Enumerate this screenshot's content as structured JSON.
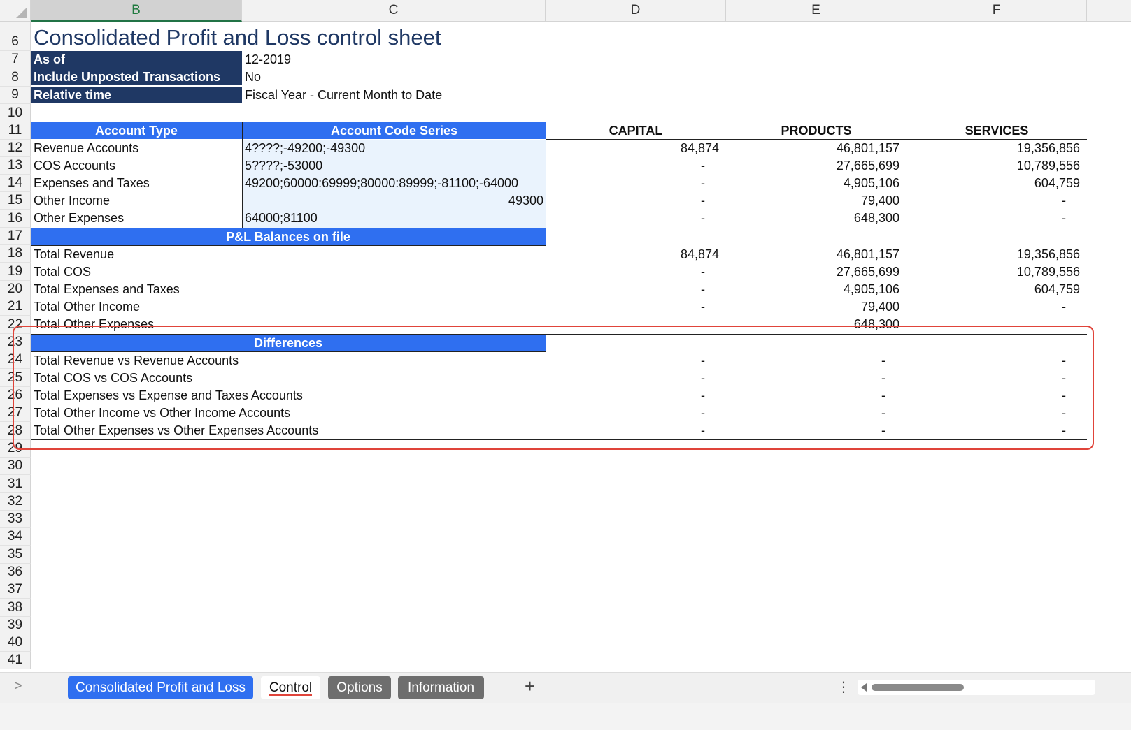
{
  "columns": [
    "B",
    "C",
    "D",
    "E",
    "F"
  ],
  "rows": [
    "6",
    "7",
    "8",
    "9",
    "10",
    "11",
    "12",
    "13",
    "14",
    "15",
    "16",
    "17",
    "18",
    "19",
    "20",
    "21",
    "22",
    "23",
    "24",
    "25",
    "26",
    "27",
    "28",
    "29",
    "30",
    "31",
    "32",
    "33",
    "34",
    "35",
    "36",
    "37",
    "38",
    "39",
    "40",
    "41"
  ],
  "title": "Consolidated Profit and Loss control sheet",
  "params": [
    {
      "label": "As of",
      "value": "12-2019"
    },
    {
      "label": "Include Unposted Transactions",
      "value": "No"
    },
    {
      "label": "Relative time",
      "value": "Fiscal Year - Current Month to Date"
    }
  ],
  "headers": {
    "account_type": "Account Type",
    "account_code_series": "Account Code Series",
    "capital": "CAPITAL",
    "products": "PRODUCTS",
    "services": "SERVICES"
  },
  "accounts": [
    {
      "type": "Revenue Accounts",
      "series": "4????;-49200;-49300",
      "capital": "84,874",
      "products": "46,801,157",
      "services": "19,356,856"
    },
    {
      "type": "COS Accounts",
      "series": "5????;-53000",
      "capital": "-",
      "products": "27,665,699",
      "services": "10,789,556"
    },
    {
      "type": "Expenses and Taxes",
      "series": "49200;60000:69999;80000:89999;-81100;-64000",
      "capital": "-",
      "products": "4,905,106",
      "services": "604,759"
    },
    {
      "type": "Other Income",
      "series": "49300",
      "capital": "-",
      "products": "79,400",
      "services": "-"
    },
    {
      "type": "Other Expenses",
      "series": "64000;81100",
      "capital": "-",
      "products": "648,300",
      "services": "-"
    }
  ],
  "balances_title": "P&L Balances on file",
  "balances": [
    {
      "label": "Total Revenue",
      "capital": "84,874",
      "products": "46,801,157",
      "services": "19,356,856"
    },
    {
      "label": "Total COS",
      "capital": "-",
      "products": "27,665,699",
      "services": "10,789,556"
    },
    {
      "label": "Total Expenses and Taxes",
      "capital": "-",
      "products": "4,905,106",
      "services": "604,759"
    },
    {
      "label": "Total Other Income",
      "capital": "-",
      "products": "79,400",
      "services": "-"
    },
    {
      "label": "Total Other Expenses",
      "capital": "",
      "products": "648,300",
      "services": ""
    }
  ],
  "differences_title": "Differences",
  "differences": [
    {
      "label": "Total Revenue vs Revenue Accounts",
      "capital": "-",
      "products": "-",
      "services": "-"
    },
    {
      "label": "Total COS vs COS Accounts",
      "capital": "-",
      "products": "-",
      "services": "-"
    },
    {
      "label": "Total Expenses vs Expense and Taxes Accounts",
      "capital": "-",
      "products": "-",
      "services": "-"
    },
    {
      "label": "Total Other Income vs Other Income Accounts",
      "capital": "-",
      "products": "-",
      "services": "-"
    },
    {
      "label": "Total Other Expenses vs Other Expenses Accounts",
      "capital": "-",
      "products": "-",
      "services": "-"
    }
  ],
  "tabs": {
    "nav": ">",
    "items": [
      "Consolidated Profit and Loss",
      "Control",
      "Options",
      "Information"
    ],
    "add": "+",
    "more": "⋮"
  },
  "colors": {
    "navy": "#1f3864",
    "blue": "#2f6ff0",
    "light": "#eaf3fd",
    "highlight": "#e0443a"
  }
}
